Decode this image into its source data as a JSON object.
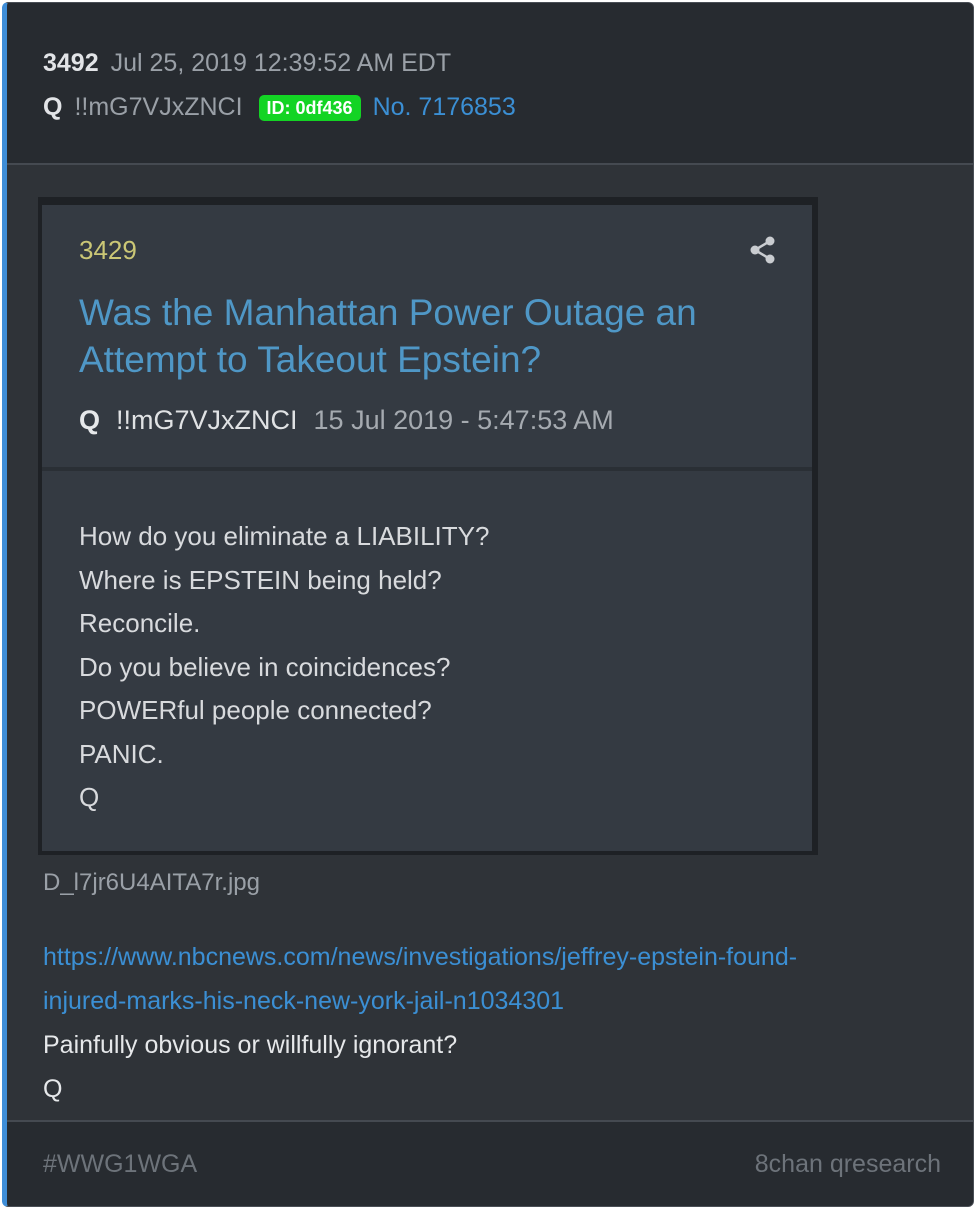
{
  "post": {
    "number": "3492",
    "date": "Jul 25, 2019 12:39:52 AM EDT",
    "author": "Q",
    "tripcode": "!!mG7VJxZNCI",
    "id_badge": "ID: 0df436",
    "post_link": "No. 7176853"
  },
  "embed": {
    "number": "3429",
    "title": "Was the Manhattan Power Outage an Attempt to Takeout Epstein?",
    "author": "Q",
    "tripcode": "!!mG7VJxZNCI",
    "date": "15 Jul 2019 - 5:47:53 AM",
    "lines": [
      "How do you eliminate a LIABILITY?",
      "Where is EPSTEIN being held?",
      "Reconcile.",
      "Do you believe in coincidences?",
      "POWERful people connected?",
      "PANIC.",
      "Q"
    ],
    "share_icon": "share-icon",
    "colors": {
      "number": "#cbc776",
      "title": "#4f97c6"
    }
  },
  "filename": "D_l7jr6U4AITA7r.jpg",
  "body": {
    "link_line1": "https://www.nbcnews.com/news/investigations/jeffrey-epstein-found-",
    "link_line2": "injured-marks-his-neck-new-york-jail-n1034301",
    "text1": "Painfully obvious or willfully ignorant?",
    "text2": "Q"
  },
  "footer": {
    "hashtag": "#WWG1WGA",
    "source": "8chan qresearch"
  },
  "colors": {
    "accent": "#3f8ed8",
    "id_badge": "#13d424",
    "link": "#3b8fd4",
    "background": "#2f3338"
  }
}
